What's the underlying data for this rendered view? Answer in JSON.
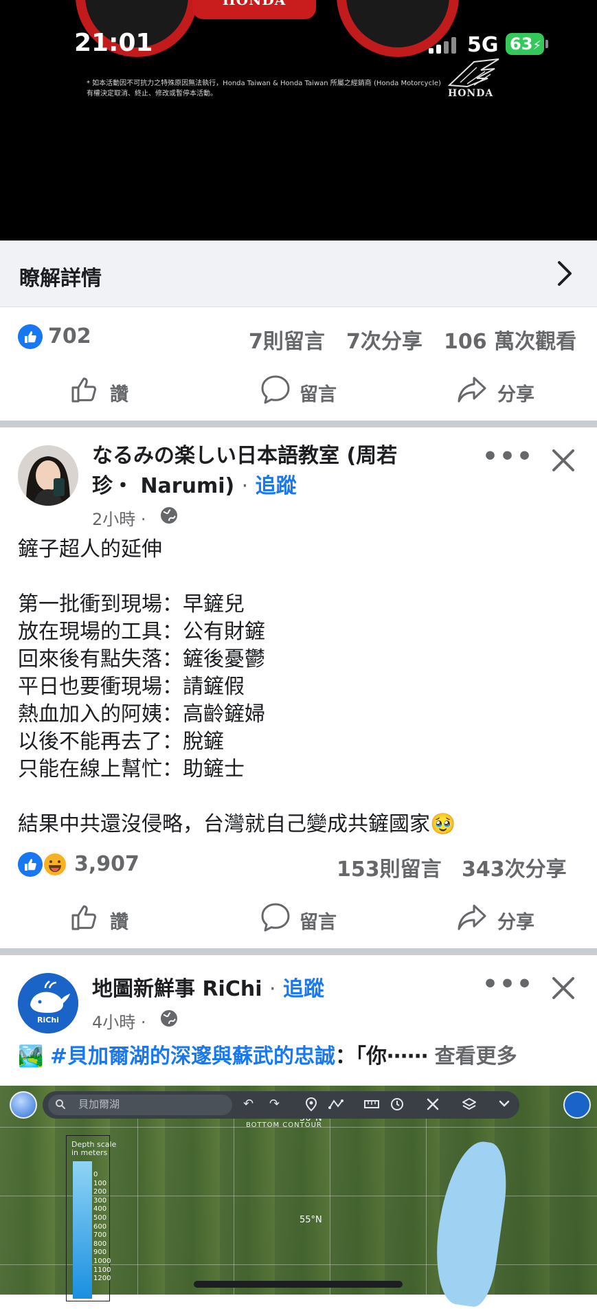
{
  "status_bar": {
    "time": "21:01",
    "network": "5G",
    "battery": "63"
  },
  "ad": {
    "product_mark": "HONDA",
    "disclaimer": "* 如本活動因不可抗力之特殊原因無法執行，Honda Taiwan & Honda Taiwan 所屬之經銷商 (Honda Motorcycle) 有權決定取消、終止、修改或暫停本活動。",
    "brand": "HONDA",
    "learn_more": "瞭解詳情",
    "stats": {
      "likes": "702",
      "comments": "7則留言",
      "shares": "7次分享",
      "views": "106 萬次觀看"
    }
  },
  "actions": {
    "like": "讚",
    "comment": "留言",
    "share": "分享"
  },
  "post1": {
    "author": "なるみの楽しい日本語教室 (周若",
    "author_line2": "珍・ Narumi)",
    "separator": "·",
    "follow": "追蹤",
    "time": "2小時",
    "body": "鏟子超人的延伸\n\n第一批衝到現場：早鏟兒\n放在現場的工具：公有財鏟\n回來後有點失落：鏟後憂鬱\n平日也要衝現場：請鏟假\n熱血加入的阿姨：高齡鏟婦\n以後不能再去了：脫鏟\n只能在線上幫忙：助鏟士\n\n結果中共還沒侵略，台灣就自己變成共鏟國家🥹",
    "stats": {
      "reactions": "3,907",
      "comments": "153則留言",
      "shares": "343次分享"
    }
  },
  "post2": {
    "author": "地圖新鮮事 RiChi",
    "separator": "·",
    "follow": "追蹤",
    "time": "4小時",
    "avatar_label": "RiChi",
    "preview_emoji": "🏞️",
    "hashtag": "#貝加爾湖的深邃與蘇武的忠誠",
    "preview": "：「你⋯⋯",
    "see_more": "查看更多",
    "map": {
      "search_placeholder": "貝加爾湖",
      "contour_label": "BOTTOM CONTOUR",
      "lat_top": "56°N",
      "lat_mid": "55°N",
      "depth_title": "Depth scale\nin meters",
      "depth_scale": "0\n100\n200\n300\n400\n500\n600\n700\n800\n900\n1000\n1100\n1200"
    }
  }
}
